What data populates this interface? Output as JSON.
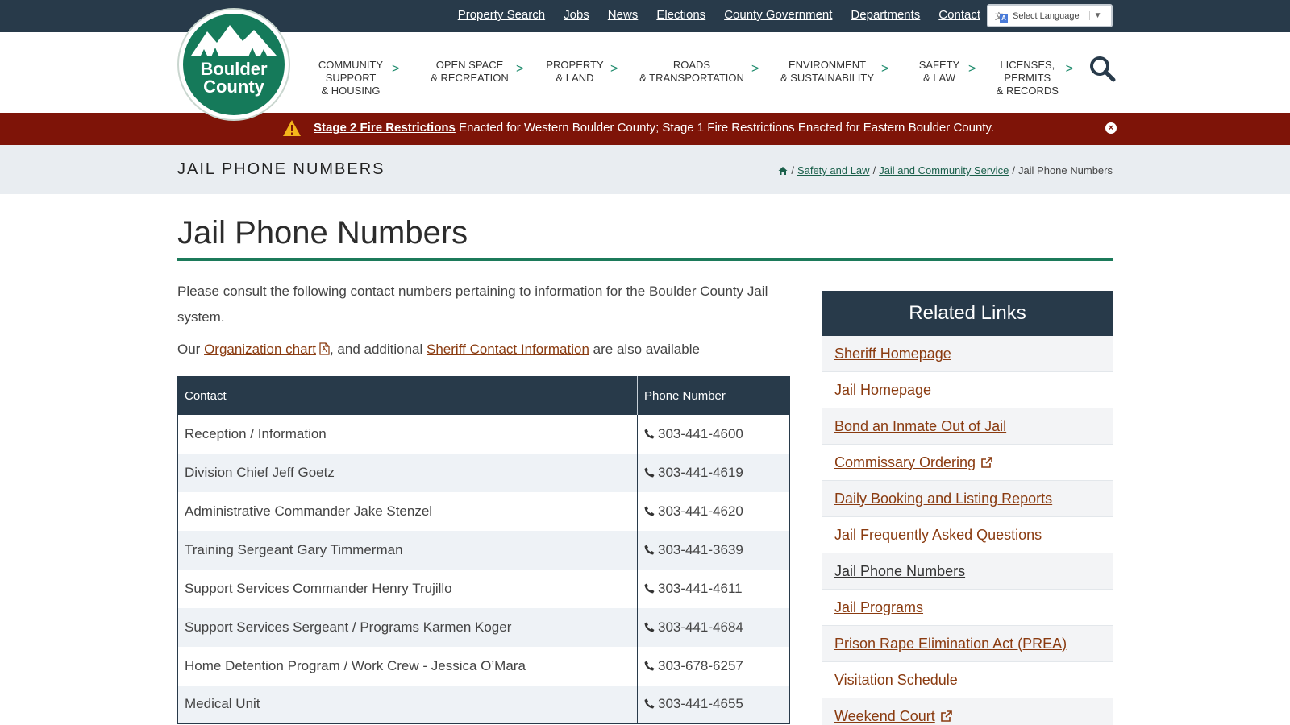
{
  "utility_nav": [
    "Property Search",
    "Jobs",
    "News",
    "Elections",
    "County Government",
    "Departments",
    "Contact"
  ],
  "translate": {
    "label": "Select Language",
    "arrow": "▼"
  },
  "logo": {
    "line1": "Boulder",
    "line2": "County"
  },
  "main_nav": [
    {
      "label": "COMMUNITY\nSUPPORT\n& HOUSING"
    },
    {
      "label": "OPEN SPACE\n& RECREATION"
    },
    {
      "label": "PROPERTY\n& LAND"
    },
    {
      "label": "ROADS\n& TRANSPORTATION"
    },
    {
      "label": "ENVIRONMENT\n& SUSTAINABILITY"
    },
    {
      "label": "SAFETY\n& LAW"
    },
    {
      "label": "LICENSES,\nPERMITS\n& RECORDS"
    }
  ],
  "nav_chevron": ">",
  "alert": {
    "link": "Stage 2 Fire Restrictions",
    "text": " Enacted for Western Boulder County; Stage 1 Fire Restrictions Enacted for Eastern Boulder County.",
    "close": "×"
  },
  "section": {
    "title": "JAIL PHONE NUMBERS"
  },
  "breadcrumb": {
    "sep": "/",
    "items": [
      "Safety and Law",
      "Jail and Community Service"
    ],
    "current": "Jail Phone Numbers"
  },
  "page": {
    "title": "Jail Phone Numbers",
    "intro": "Please consult the following contact numbers pertaining to information for the Boulder County Jail system.",
    "intro2_prefix": "Our ",
    "org_chart": "Organization chart",
    "intro2_mid": ", and additional ",
    "sheriff_contact": "Sheriff Contact Information",
    "intro2_suffix": " are also available"
  },
  "table": {
    "headers": [
      "Contact",
      "Phone Number"
    ],
    "rows": [
      {
        "contact": "Reception / Information",
        "phone": "303-441-4600"
      },
      {
        "contact": "Division Chief Jeff Goetz",
        "phone": "303-441-4619"
      },
      {
        "contact": "Administrative Commander Jake Stenzel",
        "phone": "303-441-4620"
      },
      {
        "contact": "Training Sergeant Gary Timmerman",
        "phone": "303-441-3639"
      },
      {
        "contact": "Support Services Commander Henry Trujillo",
        "phone": "303-441-4611"
      },
      {
        "contact": "Support Services Sergeant / Programs Karmen Koger",
        "phone": "303-441-4684"
      },
      {
        "contact": "Home Detention Program / Work Crew - Jessica O’Mara",
        "phone": "303-678-6257"
      },
      {
        "contact": "Medical Unit",
        "phone": "303-441-4655"
      }
    ]
  },
  "related": {
    "title": "Related Links",
    "links": [
      {
        "label": "Sheriff Homepage",
        "external": false
      },
      {
        "label": "Jail Homepage",
        "external": false
      },
      {
        "label": "Bond an Inmate Out of Jail",
        "external": false
      },
      {
        "label": "Commissary Ordering",
        "external": true
      },
      {
        "label": "Daily Booking and Listing Reports",
        "external": false
      },
      {
        "label": "Jail Frequently Asked Questions",
        "external": false
      },
      {
        "label": "Jail Phone Numbers",
        "external": false,
        "current": true
      },
      {
        "label": "Jail Programs",
        "external": false
      },
      {
        "label": "Prison Rape Elimination Act (PREA)",
        "external": false
      },
      {
        "label": "Visitation Schedule",
        "external": false
      },
      {
        "label": "Weekend Court",
        "external": true
      }
    ]
  },
  "colors": {
    "header_navy": "#283a4a",
    "brand_green": "#157a5a",
    "alert_red": "#7e1408",
    "link_brown": "#8a3b10"
  }
}
